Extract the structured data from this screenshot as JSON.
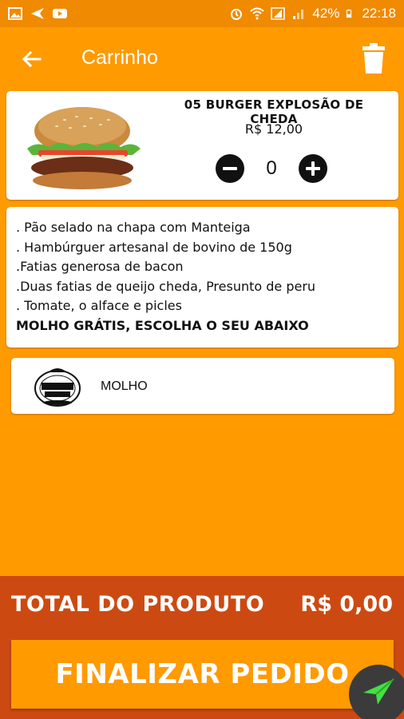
{
  "status_bar": {
    "battery": "42%",
    "time": "22:18"
  },
  "app_bar": {
    "title": "Carrinho",
    "back_icon": "arrow-back-icon",
    "delete_icon": "trash-icon"
  },
  "product": {
    "name": "05 BURGER EXPLOSÃO DE CHEDA",
    "price": "R$ 12,00",
    "quantity": "0"
  },
  "description": {
    "lines": [
      ". Pão selado na chapa com Manteiga",
      ". Hambúrguer artesanal de bovino  de 150g",
      ".Fatias generosa de bacon",
      ".Duas fatias de queijo cheda, Presunto de peru",
      ". Tomate, o alface e picles",
      "MOLHO GRÁTIS, ESCOLHA O SEU ABAIXO"
    ]
  },
  "sauce": {
    "label": "MOLHO"
  },
  "footer": {
    "total_label": "TOTAL DO PRODUTO",
    "total_value": "R$ 0,00",
    "finalize_label": "FINALIZAR PEDIDO"
  },
  "colors": {
    "primary": "#FF9A00",
    "footer": "#CC4A12",
    "fab": "#3B3B3B",
    "fab_icon": "#43E043"
  }
}
